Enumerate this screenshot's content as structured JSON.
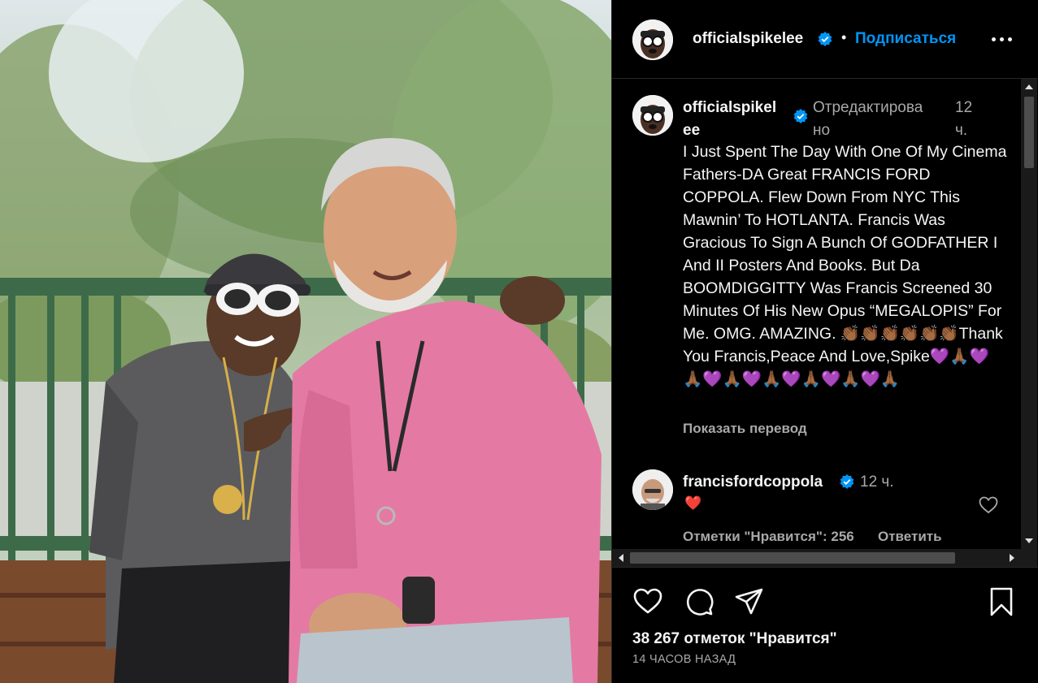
{
  "post": {
    "author": "officialspikelee",
    "follow_label": "Подписаться",
    "separator": "•",
    "caption": {
      "username_line1": "officialspikel",
      "username_line2": "ee",
      "edited_line1": "Отредактирова",
      "edited_line2": "но",
      "time_line1": "12",
      "time_line2": "ч.",
      "text": "I Just Spent The Day With One Of My Cinema Fathers-DA Great FRANCIS FORD COPPOLA. Flew Down From NYC This Mawnin’ To HOTLANTA. Francis Was Gracious To Sign A Bunch Of GODFATHER I And II Posters And Books. But Da BOOMDIGGITTY Was Francis Screened 30 Minutes Of His New Opus “MEGALOPIS” For Me. OMG. AMAZING. 👏🏾👏🏾👏🏾👏🏾👏🏾👏🏾Thank You Francis,Peace And Love,Spike💜🙏🏾💜🙏🏾💜🙏🏾💜🙏🏾💜🙏🏾💜🙏🏾💜🙏🏾",
      "translate_label": "Показать перевод"
    },
    "comment": {
      "username": "francisfordcoppola",
      "time": "12 ч.",
      "text": "❤️",
      "likes_label": "Отметки \"Нравится\": 256",
      "reply_label": "Ответить"
    },
    "likes_label": "38 267 отметок \"Нравится\"",
    "timestamp": "14 ЧАСОВ НАЗАД"
  },
  "icons": {
    "verified": "verified-badge-icon",
    "more": "more-options-icon",
    "like": "heart-icon",
    "comment": "comment-icon",
    "share": "share-icon",
    "save": "bookmark-icon"
  },
  "colors": {
    "accent": "#0095f6",
    "verified": "#0095f6",
    "secondary_text": "#a8a8a8",
    "comment_heart": "#ed1c24"
  }
}
